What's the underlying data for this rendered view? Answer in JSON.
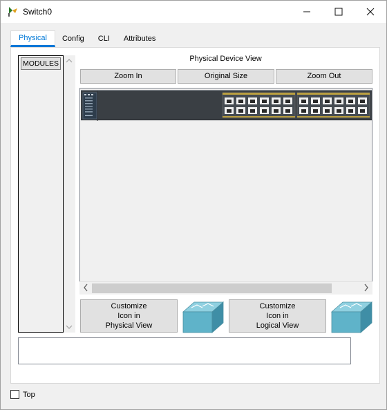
{
  "window": {
    "title": "Switch0",
    "minimize_glyph": "—",
    "maximize_glyph": "☐",
    "close_glyph": "✕"
  },
  "tabs": [
    {
      "label": "Physical",
      "active": true
    },
    {
      "label": "Config",
      "active": false
    },
    {
      "label": "CLI",
      "active": false
    },
    {
      "label": "Attributes",
      "active": false
    }
  ],
  "modules": {
    "button_label": "MODULES"
  },
  "physical_view": {
    "title": "Physical Device View",
    "zoom_in": "Zoom In",
    "original_size": "Original Size",
    "zoom_out": "Zoom Out"
  },
  "customize": {
    "physical": {
      "line1": "Customize",
      "line2": "Icon in",
      "line3": "Physical View"
    },
    "logical": {
      "line1": "Customize",
      "line2": "Icon in",
      "line3": "Logical View"
    }
  },
  "footer": {
    "top_label": "Top",
    "top_checked": false
  },
  "colors": {
    "accent": "#0078d7",
    "switch_icon": "#5fb3c9",
    "chassis": "#3a3f44"
  },
  "icons": [
    "packet-tracer-app-icon",
    "switch-icon",
    "scroll-left-icon",
    "scroll-right-icon"
  ]
}
